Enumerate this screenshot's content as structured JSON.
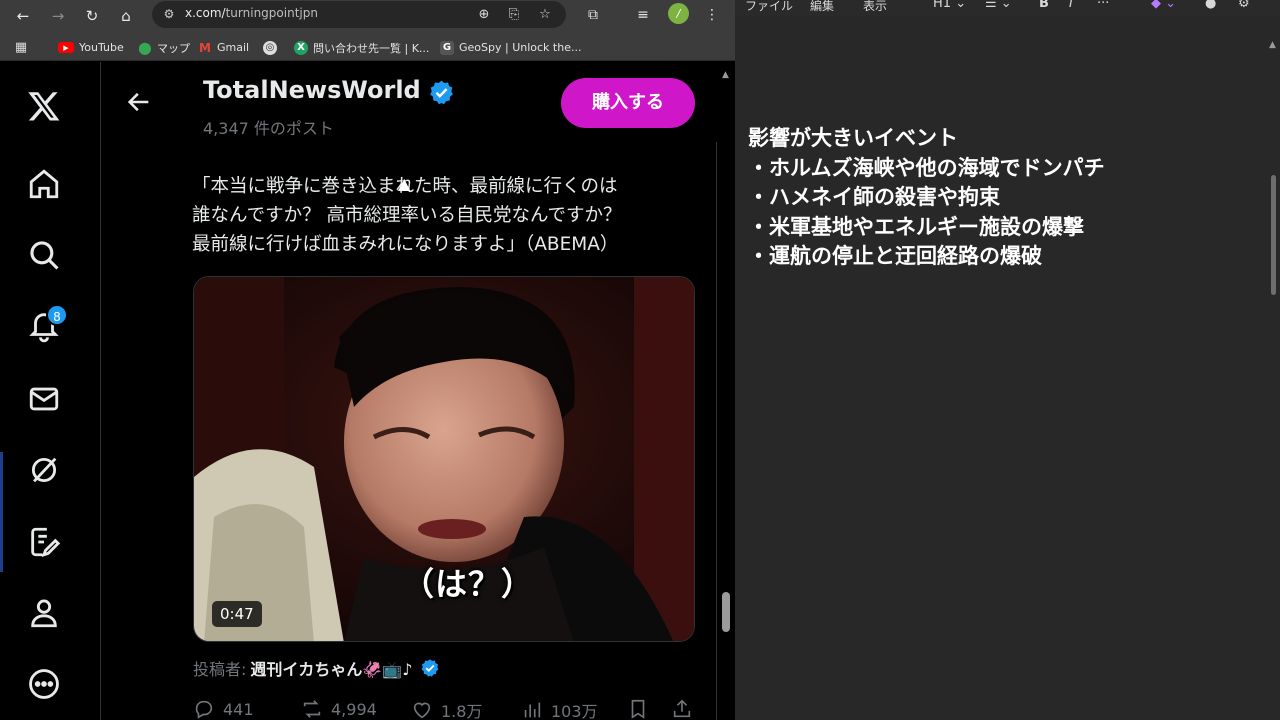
{
  "browser": {
    "url_prefix": "x.com/",
    "url_path": "turningpointjpn",
    "profile_initial": "/",
    "bookmarks": [
      {
        "label": "YouTube",
        "icon": "youtube-icon",
        "color": "#ff0000"
      },
      {
        "label": "マップ",
        "icon": "maps-pin-icon",
        "color": "#34a853"
      },
      {
        "label": "Gmail",
        "icon": "gmail-icon",
        "color": "#ea4335"
      },
      {
        "label": "",
        "icon": "globe-icon",
        "color": "#dddddd"
      },
      {
        "label": "問い合わせ先一覧 | K...",
        "icon": "green-x-icon",
        "color": "#21a366"
      },
      {
        "label": "GeoSpy | Unlock the...",
        "icon": "geospy-icon",
        "color": "#444444"
      }
    ]
  },
  "x": {
    "notification_count": "8",
    "profile": {
      "name": "TotalNewsWorld",
      "post_count": "4,347 件のポスト",
      "buy_label": "購入する"
    },
    "post": {
      "text_lines": [
        "「本当に戦争に巻き込まれた時、最前線に行くのは",
        "誰なんですか？ 高市総理率いる自民党なんですか？",
        "最前線に行けば血まみれになりますよ」（ABEMA）"
      ],
      "video_caption": "（は？）",
      "video_duration": "0:47",
      "poster_label": "投稿者:",
      "poster_name": "週刊イカちゃん🦑📺♪",
      "replies": "441",
      "reposts": "4,994",
      "likes": "1.8万",
      "views": "103万"
    }
  },
  "notepad": {
    "menu": [
      "ファイル",
      "編集",
      "表示"
    ],
    "heading_label": "H1",
    "lines": [
      "影響が大きいイベント",
      "・ホルムズ海峡や他の海域でドンパチ",
      "・ハメネイ師の殺害や拘束",
      "・米軍基地やエネルギー施設の爆撃",
      "・運航の停止と迂回経路の爆破"
    ]
  },
  "colors": {
    "x_accent": "#1d9bf0",
    "buy_button": "#d016c9",
    "x_text": "#e7e9ea",
    "x_muted": "#71767b"
  }
}
